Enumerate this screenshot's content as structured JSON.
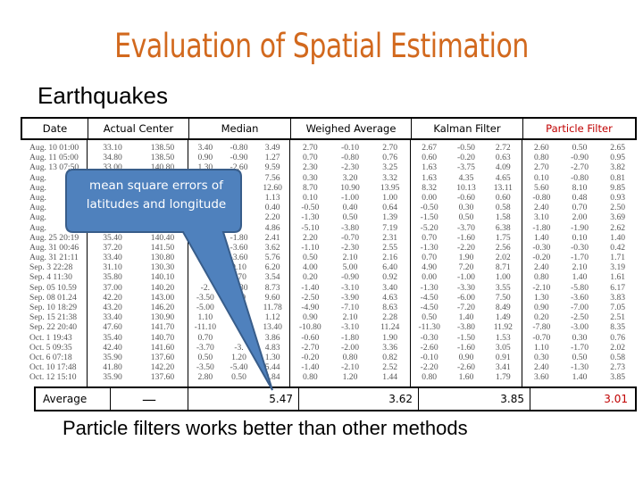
{
  "title": "Evaluation of Spatial Estimation",
  "subtitle": "Earthquakes",
  "table": {
    "headers": {
      "date": "Date",
      "actual_center": "Actual Center",
      "median": "Median",
      "weighed_average": "Weighed Average",
      "kalman_filter": "Kalman Filter",
      "particle_filter": "Particle Filter"
    },
    "rows": [
      {
        "date": "Aug. 10 01:00",
        "actual": [
          "33.10",
          "138.50"
        ],
        "median": [
          "3.40",
          "-0.80",
          "3.49"
        ],
        "weighed": [
          "2.70",
          "-0.10",
          "2.70"
        ],
        "kalman": [
          "2.67",
          "-0.50",
          "2.72"
        ],
        "particle": [
          "2.60",
          "0.50",
          "2.65"
        ]
      },
      {
        "date": "Aug. 11 05:00",
        "actual": [
          "34.80",
          "138.50"
        ],
        "median": [
          "0.90",
          "-0.90",
          "1.27"
        ],
        "weighed": [
          "0.70",
          "-0.80",
          "0.76"
        ],
        "kalman": [
          "0.60",
          "-0.20",
          "0.63"
        ],
        "particle": [
          "0.80",
          "-0.90",
          "0.95"
        ]
      },
      {
        "date": "Aug. 13 07:50",
        "actual": [
          "33.00",
          "140.80"
        ],
        "median": [
          "1.30",
          "-2.60",
          "9.59"
        ],
        "weighed": [
          "2.30",
          "-2.30",
          "3.25"
        ],
        "kalman": [
          "1.63",
          "-3.75",
          "4.09"
        ],
        "particle": [
          "2.70",
          "-2.70",
          "3.82"
        ]
      },
      {
        "date": "Aug.",
        "actual": [
          "",
          ""
        ],
        "median": [
          "",
          "",
          "7.56"
        ],
        "weighed": [
          "0.30",
          "3.20",
          "3.32"
        ],
        "kalman": [
          "1.63",
          "4.35",
          "4.65"
        ],
        "particle": [
          "0.10",
          "-0.80",
          "0.81"
        ]
      },
      {
        "date": "Aug.",
        "actual": [
          "",
          ""
        ],
        "median": [
          "",
          "",
          "12.60"
        ],
        "weighed": [
          "8.70",
          "10.90",
          "13.95"
        ],
        "kalman": [
          "8.32",
          "10.13",
          "13.11"
        ],
        "particle": [
          "5.60",
          "8.10",
          "9.85"
        ]
      },
      {
        "date": "Aug.",
        "actual": [
          "",
          ""
        ],
        "median": [
          "",
          "",
          "1.13"
        ],
        "weighed": [
          "0.10",
          "-1.00",
          "1.00"
        ],
        "kalman": [
          "0.00",
          "-0.60",
          "0.60"
        ],
        "particle": [
          "-0.80",
          "0.48",
          "0.93"
        ]
      },
      {
        "date": "Aug.",
        "actual": [
          "",
          ""
        ],
        "median": [
          "",
          "",
          "0.40"
        ],
        "weighed": [
          "-0.50",
          "0.40",
          "0.64"
        ],
        "kalman": [
          "-0.50",
          "0.30",
          "0.58"
        ],
        "particle": [
          "2.40",
          "0.70",
          "2.50"
        ]
      },
      {
        "date": "Aug.",
        "actual": [
          "",
          ""
        ],
        "median": [
          "",
          "",
          "2.20"
        ],
        "weighed": [
          "-1.30",
          "0.50",
          "1.39"
        ],
        "kalman": [
          "-1.50",
          "0.50",
          "1.58"
        ],
        "particle": [
          "3.10",
          "2.00",
          "3.69"
        ]
      },
      {
        "date": "Aug.",
        "actual": [
          "",
          ""
        ],
        "median": [
          "",
          "",
          "4.86"
        ],
        "weighed": [
          "-5.10",
          "-3.80",
          "7.19"
        ],
        "kalman": [
          "-5.20",
          "-3.70",
          "6.38"
        ],
        "particle": [
          "-1.80",
          "-1.90",
          "2.62"
        ]
      },
      {
        "date": "Aug. 25 20:19",
        "actual": [
          "35.40",
          "140.40"
        ],
        "median": [
          "",
          "-1.80",
          "2.41"
        ],
        "weighed": [
          "2.20",
          "-0.70",
          "2.31"
        ],
        "kalman": [
          "0.70",
          "-1.60",
          "1.75"
        ],
        "particle": [
          "1.40",
          "0.10",
          "1.40"
        ]
      },
      {
        "date": "Aug. 31 00:46",
        "actual": [
          "37.20",
          "141.50"
        ],
        "median": [
          "",
          "-3.60",
          "3.62"
        ],
        "weighed": [
          "-1.10",
          "-2.30",
          "2.55"
        ],
        "kalman": [
          "-1.30",
          "-2.20",
          "2.56"
        ],
        "particle": [
          "-0.30",
          "-0.30",
          "0.42"
        ]
      },
      {
        "date": "Aug. 31 21:11",
        "actual": [
          "33.40",
          "130.80"
        ],
        "median": [
          "",
          "-3.60",
          "5.76"
        ],
        "weighed": [
          "0.50",
          "2.10",
          "2.16"
        ],
        "kalman": [
          "0.70",
          "1.90",
          "2.02"
        ],
        "particle": [
          "-0.20",
          "-1.70",
          "1.71"
        ]
      },
      {
        "date": "Sep. 3 22:28",
        "actual": [
          "31.10",
          "130.30"
        ],
        "median": [
          "",
          "0.10",
          "6.20"
        ],
        "weighed": [
          "4.00",
          "5.00",
          "6.40"
        ],
        "kalman": [
          "4.90",
          "7.20",
          "8.71"
        ],
        "particle": [
          "2.40",
          "2.10",
          "3.19"
        ]
      },
      {
        "date": "Sep. 4 11:30",
        "actual": [
          "35.80",
          "140.10"
        ],
        "median": [
          "",
          "1.70",
          "3.54"
        ],
        "weighed": [
          "0.20",
          "-0.90",
          "0.92"
        ],
        "kalman": [
          "0.00",
          "-1.00",
          "1.00"
        ],
        "particle": [
          "0.80",
          "1.40",
          "1.61"
        ]
      },
      {
        "date": "Sep. 05 10.59",
        "actual": [
          "37.00",
          "140.20"
        ],
        "median": [
          "-2.",
          "-3.30",
          "8.73"
        ],
        "weighed": [
          "-1.40",
          "-3.10",
          "3.40"
        ],
        "kalman": [
          "-1.30",
          "-3.30",
          "3.55"
        ],
        "particle": [
          "-2.10",
          "-5.80",
          "6.17"
        ]
      },
      {
        "date": "Sep. 08 01.24",
        "actual": [
          "42.20",
          "143.00"
        ],
        "median": [
          "-3.50",
          "-.90",
          "9.60"
        ],
        "weighed": [
          "-2.50",
          "-3.90",
          "4.63"
        ],
        "kalman": [
          "-4.50",
          "-6.00",
          "7.50"
        ],
        "particle": [
          "1.30",
          "-3.60",
          "3.83"
        ]
      },
      {
        "date": "Sep. 10 18:29",
        "actual": [
          "43.20",
          "146.20"
        ],
        "median": [
          "-5.00",
          "-.20",
          "11.78"
        ],
        "weighed": [
          "-4.90",
          "-7.10",
          "8.63"
        ],
        "kalman": [
          "-4.50",
          "-7.20",
          "8.49"
        ],
        "particle": [
          "0.90",
          "-7.00",
          "7.05"
        ]
      },
      {
        "date": "Sep. 15 21:38",
        "actual": [
          "33.40",
          "130.90"
        ],
        "median": [
          "1.10",
          "",
          "1.12"
        ],
        "weighed": [
          "0.90",
          "2.10",
          "2.28"
        ],
        "kalman": [
          "0.50",
          "1.40",
          "1.49"
        ],
        "particle": [
          "0.20",
          "-2.50",
          "2.51"
        ]
      },
      {
        "date": "Sep. 22 20:40",
        "actual": [
          "47.60",
          "141.70"
        ],
        "median": [
          "-11.10",
          "",
          "13.40"
        ],
        "weighed": [
          "-10.80",
          "-3.10",
          "11.24"
        ],
        "kalman": [
          "-11.30",
          "-3.80",
          "11.92"
        ],
        "particle": [
          "-7.80",
          "-3.00",
          "8.35"
        ]
      },
      {
        "date": "Oct. 1 19:43",
        "actual": [
          "35.40",
          "140.70"
        ],
        "median": [
          "0.70",
          "",
          "3.86"
        ],
        "weighed": [
          "-0.60",
          "-1.80",
          "1.90"
        ],
        "kalman": [
          "-0.30",
          "-1.50",
          "1.53"
        ],
        "particle": [
          "-0.70",
          "0.30",
          "0.76"
        ]
      },
      {
        "date": "Oct. 5 09:35",
        "actual": [
          "42.40",
          "141.60"
        ],
        "median": [
          "-3.70",
          "-3.",
          "4.83"
        ],
        "weighed": [
          "-2.70",
          "-2.00",
          "3.36"
        ],
        "kalman": [
          "-2.60",
          "-1.60",
          "3.05"
        ],
        "particle": [
          "1.10",
          "-1.70",
          "2.02"
        ]
      },
      {
        "date": "Oct. 6 07:18",
        "actual": [
          "35.90",
          "137.60"
        ],
        "median": [
          "0.50",
          "1.20",
          "1.30"
        ],
        "weighed": [
          "-0.20",
          "0.80",
          "0.82"
        ],
        "kalman": [
          "-0.10",
          "0.90",
          "0.91"
        ],
        "particle": [
          "0.30",
          "0.50",
          "0.58"
        ]
      },
      {
        "date": "Oct. 10 17:48",
        "actual": [
          "41.80",
          "142.20"
        ],
        "median": [
          "-3.50",
          "-5.40",
          "5.44"
        ],
        "weighed": [
          "-1.40",
          "-2.10",
          "2.52"
        ],
        "kalman": [
          "-2.20",
          "-2.60",
          "3.41"
        ],
        "particle": [
          "2.40",
          "-1.30",
          "2.73"
        ]
      },
      {
        "date": "Oct. 12 15:10",
        "actual": [
          "35.90",
          "137.60"
        ],
        "median": [
          "2.80",
          "0.50",
          "2.84"
        ],
        "weighed": [
          "0.80",
          "1.20",
          "1.44"
        ],
        "kalman": [
          "0.80",
          "1.60",
          "1.79"
        ],
        "particle": [
          "3.60",
          "1.40",
          "3.85"
        ]
      }
    ],
    "average": {
      "label": "Average",
      "actual_center": "—",
      "median": "5.47",
      "weighed_average": "3.62",
      "kalman_filter": "3.85",
      "particle_filter": "3.01"
    }
  },
  "callout": {
    "line1": "mean square errors of",
    "line2": "latitudes and longitude"
  },
  "conclusion": "Particle filters works better than other methods",
  "colors": {
    "title": "#d2691e",
    "highlight": "#c00000",
    "callout_fill": "#4f81bd",
    "callout_stroke": "#385d8a"
  }
}
